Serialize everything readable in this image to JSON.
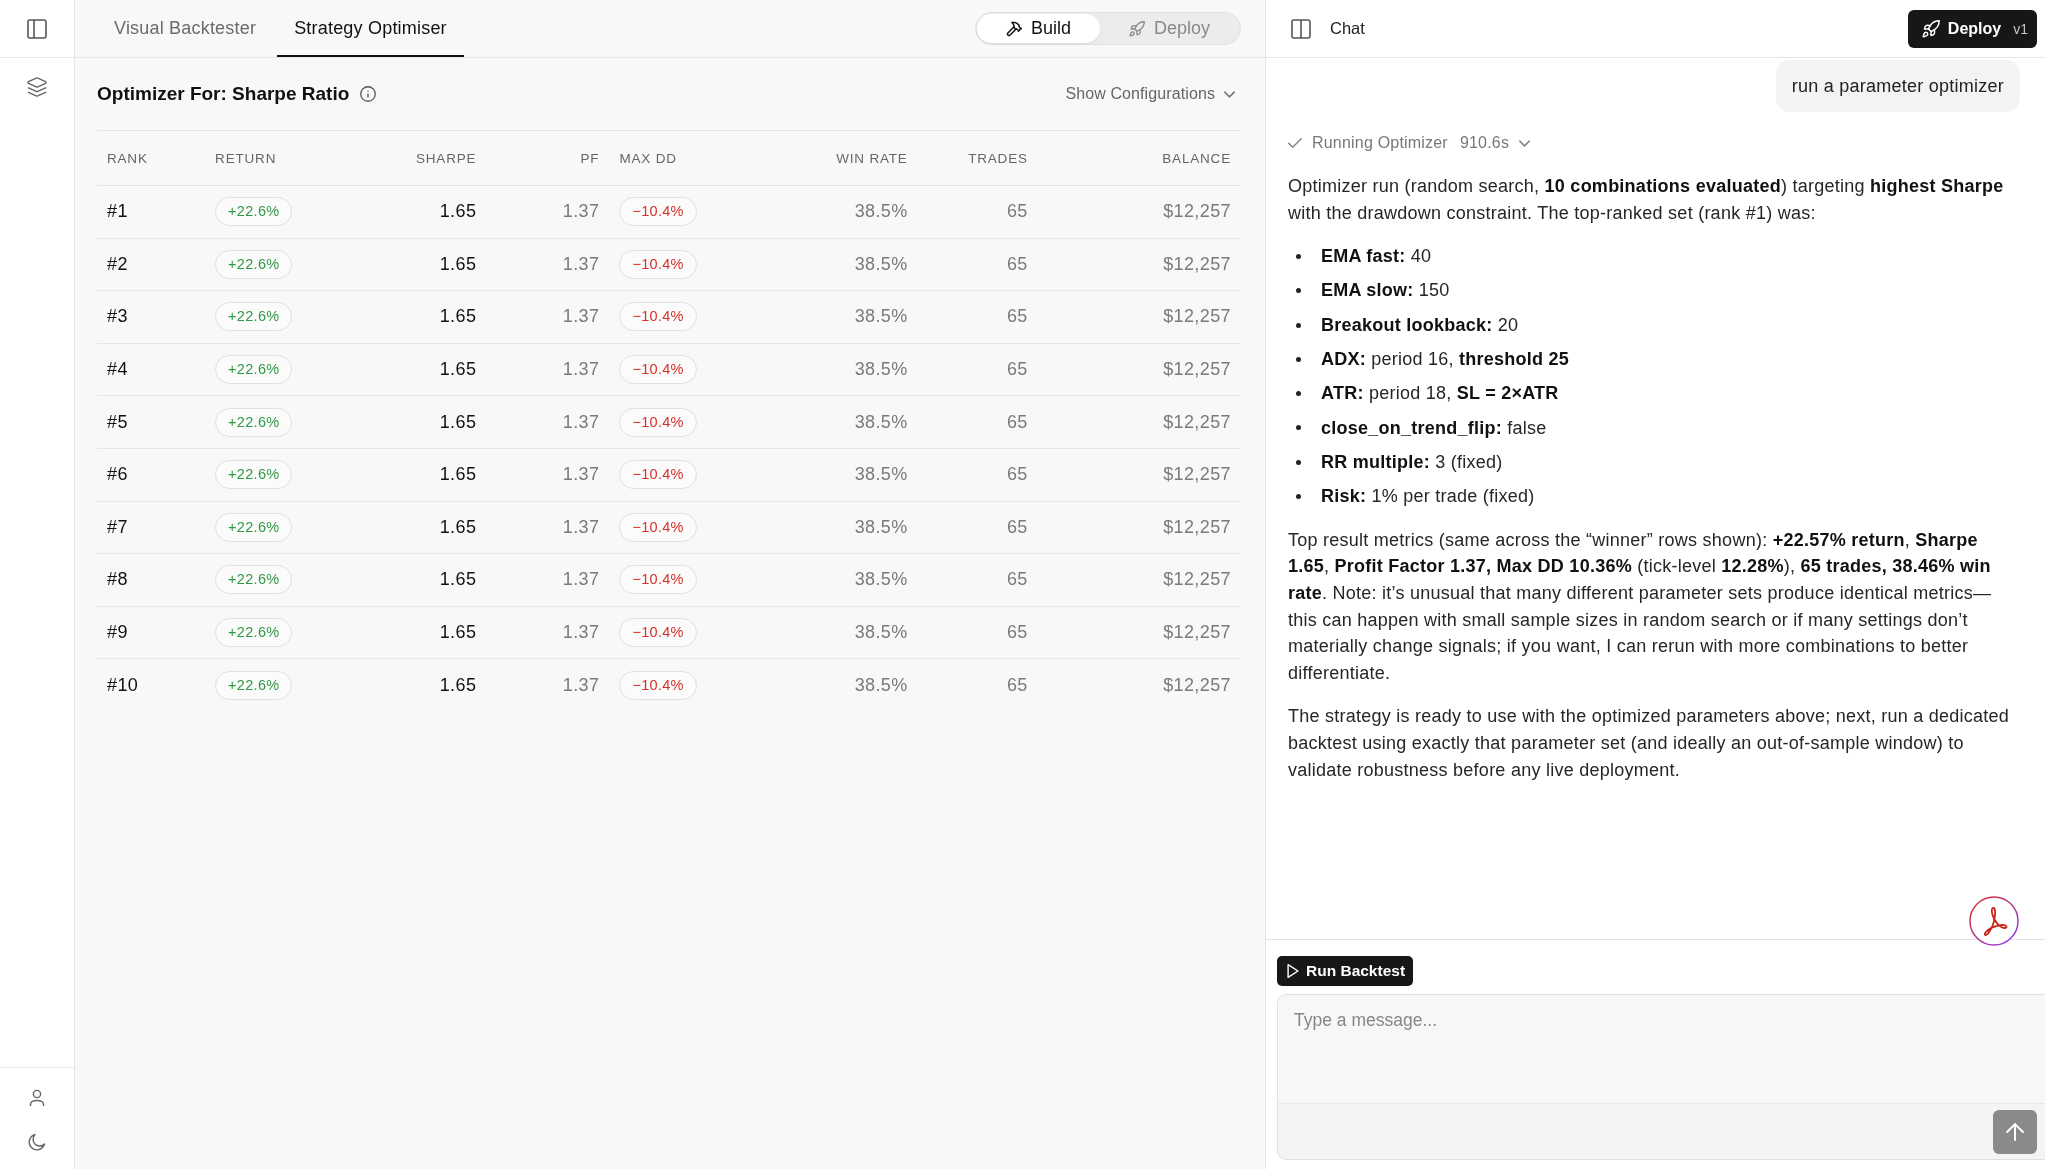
{
  "tabs": [
    {
      "label": "Visual Backtester",
      "selected": false
    },
    {
      "label": "Strategy Optimiser",
      "selected": true
    }
  ],
  "mode_switch": [
    {
      "label": "Build",
      "selected": true
    },
    {
      "label": "Deploy",
      "selected": false
    }
  ],
  "optimizer": {
    "title": "Optimizer For: Sharpe Ratio",
    "config_toggle": "Show Configurations"
  },
  "table": {
    "columns": [
      {
        "label": "RANK",
        "kind": "rank"
      },
      {
        "label": "RETURN",
        "kind": "gain"
      },
      {
        "label": "SHARPE",
        "kind": "primary"
      },
      {
        "label": "PF",
        "kind": "muted"
      },
      {
        "label": "MAX DD",
        "kind": "loss"
      },
      {
        "label": "WIN RATE",
        "kind": "muted"
      },
      {
        "label": "TRADES",
        "kind": "muted"
      },
      {
        "label": "BALANCE",
        "kind": "muted"
      }
    ],
    "rows": [
      [
        "#1",
        "+22.6%",
        "1.65",
        "1.37",
        "−10.4%",
        "38.5%",
        "65",
        "$12,257"
      ],
      [
        "#2",
        "+22.6%",
        "1.65",
        "1.37",
        "−10.4%",
        "38.5%",
        "65",
        "$12,257"
      ],
      [
        "#3",
        "+22.6%",
        "1.65",
        "1.37",
        "−10.4%",
        "38.5%",
        "65",
        "$12,257"
      ],
      [
        "#4",
        "+22.6%",
        "1.65",
        "1.37",
        "−10.4%",
        "38.5%",
        "65",
        "$12,257"
      ],
      [
        "#5",
        "+22.6%",
        "1.65",
        "1.37",
        "−10.4%",
        "38.5%",
        "65",
        "$12,257"
      ],
      [
        "#6",
        "+22.6%",
        "1.65",
        "1.37",
        "−10.4%",
        "38.5%",
        "65",
        "$12,257"
      ],
      [
        "#7",
        "+22.6%",
        "1.65",
        "1.37",
        "−10.4%",
        "38.5%",
        "65",
        "$12,257"
      ],
      [
        "#8",
        "+22.6%",
        "1.65",
        "1.37",
        "−10.4%",
        "38.5%",
        "65",
        "$12,257"
      ],
      [
        "#9",
        "+22.6%",
        "1.65",
        "1.37",
        "−10.4%",
        "38.5%",
        "65",
        "$12,257"
      ],
      [
        "#10",
        "+22.6%",
        "1.65",
        "1.37",
        "−10.4%",
        "38.5%",
        "65",
        "$12,257"
      ]
    ]
  },
  "chat": {
    "title": "Chat",
    "deploy_button": {
      "label": "Deploy",
      "version": "v1"
    },
    "messages": [
      {
        "kind": "user",
        "text": "run a parameter optimizer"
      },
      {
        "kind": "tool",
        "label": "Running Optimizer",
        "duration": "910.6s",
        "completed": true
      },
      {
        "kind": "assistant",
        "blocks": [
          {
            "kind": "paragraph",
            "text": "Optimizer run (random search, **10 combinations evaluated**) targeting **highest Sharpe** with the drawdown constraint. The top-ranked set (rank #1) was:"
          },
          {
            "kind": "list",
            "items": [
              "**EMA fast:** 40",
              "**EMA slow:** 150",
              "**Breakout lookback:** 20",
              "**ADX:** period 16, **threshold 25**",
              "**ATR:** period 18, **SL = 2×ATR**",
              "**close_on_trend_flip:** false",
              "**RR multiple:** 3 (fixed)",
              "**Risk:** 1% per trade (fixed)"
            ]
          },
          {
            "kind": "paragraph",
            "text": "Top result metrics (same across the “winner” rows shown): **+22.57% return**, **Sharpe 1.65**, **Profit Factor 1.37, Max DD 10.36%** (tick-level **12.28%**), **65 trades, 38.46% win rate**. Note: it’s unusual that many different parameter sets produce identical metrics—this can happen with small sample sizes in random search or if many settings don’t materially change signals; if you want, I can rerun with more combinations to better differentiate."
          },
          {
            "kind": "paragraph",
            "text": "The strategy is ready to use with the optimized parameters above; next, run a dedicated backtest using exactly that parameter set (and ideally an out-of-sample window) to validate robustness before any live deployment."
          }
        ]
      }
    ],
    "composer": {
      "action_button": "Run Backtest",
      "placeholder": "Type a message..."
    }
  }
}
